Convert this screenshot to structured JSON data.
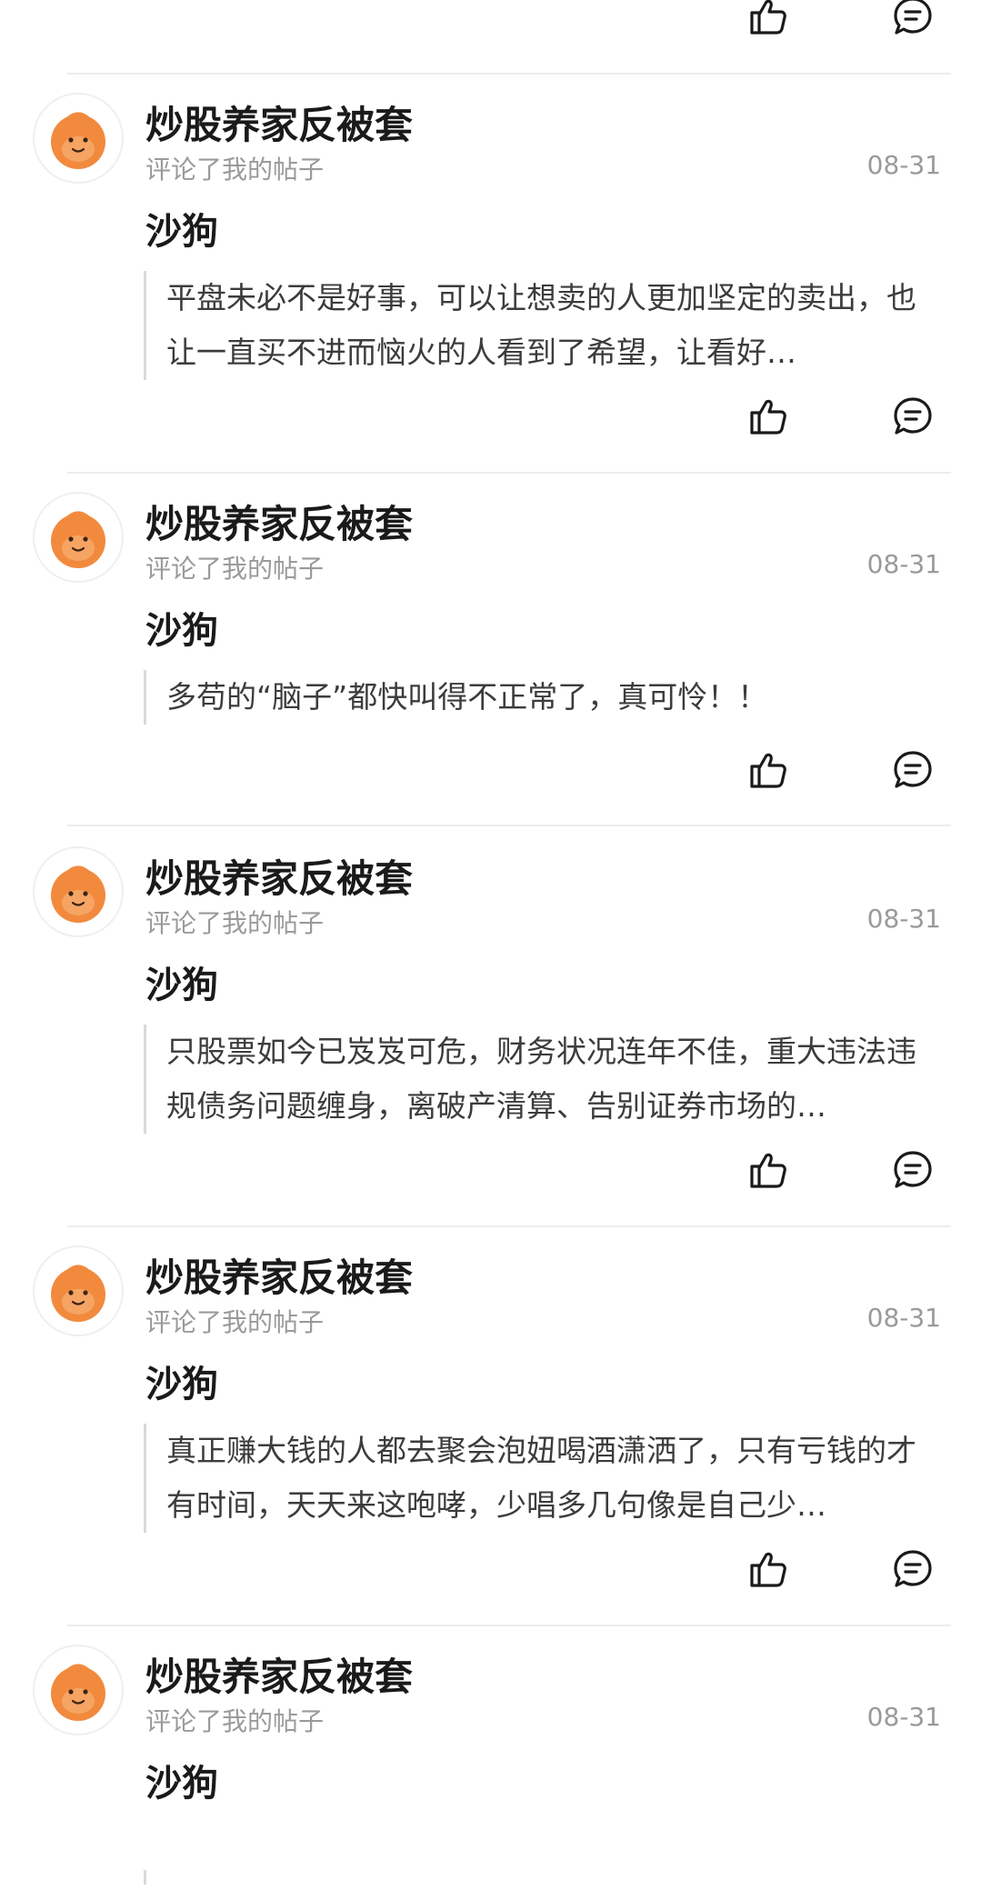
{
  "colors": {
    "accent_avatar": "#F28A3E",
    "divider": "#ECECEC",
    "secondary_text": "#9A9A9A"
  },
  "icons": {
    "like": "thumbs-up-icon",
    "reply": "comment-bubble-icon",
    "avatar": "monkey-avatar-icon"
  },
  "notifications": [
    {
      "user": "炒股养家反被套",
      "action": "评论了我的帖子",
      "date": "08-31",
      "post_title": "沙狗",
      "comment": "平盘未必不是好事，可以让想卖的人更加坚定的卖出，也让一直买不进而恼火的人看到了希望，让看好…"
    },
    {
      "user": "炒股养家反被套",
      "action": "评论了我的帖子",
      "date": "08-31",
      "post_title": "沙狗",
      "comment": "多苟的“脑子”都快叫得不正常了，真可怜！！"
    },
    {
      "user": "炒股养家反被套",
      "action": "评论了我的帖子",
      "date": "08-31",
      "post_title": "沙狗",
      "comment": "只股票如今已岌岌可危，财务状况连年不佳，重大违法违规债务问题缠身，离破产清算、告别证券市场的…"
    },
    {
      "user": "炒股养家反被套",
      "action": "评论了我的帖子",
      "date": "08-31",
      "post_title": "沙狗",
      "comment": "真正赚大钱的人都去聚会泡妞喝酒潇洒了，只有亏钱的才有时间，天天来这咆哮，少唱多几句像是自己少…"
    },
    {
      "user": "炒股养家反被套",
      "action": "评论了我的帖子",
      "date": "08-31",
      "post_title": "沙狗",
      "comment": ""
    }
  ]
}
